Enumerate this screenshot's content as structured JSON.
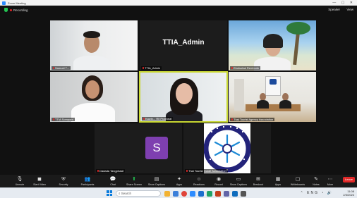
{
  "window": {
    "title": "Zoom Meeting",
    "controls": "— ▢ ✕"
  },
  "subbar": {
    "recording": "Recording",
    "speaker": "Speaker",
    "view": "View"
  },
  "tiles": [
    {
      "name": "Samuel T..."
    },
    {
      "name": "TTIA_Admin",
      "big_label": "TTIA_Admin"
    },
    {
      "name": "Ebulsotad Rembonk"
    },
    {
      "name": "TTIA Somporn"
    },
    {
      "name": "Kawin... Rit Prakheat"
    },
    {
      "name": "Thai Tourist Agency Association"
    },
    {
      "name": "Dadada Tangphasit",
      "avatar_letter": "S"
    },
    {
      "name": "Thai Tourist Guide Association"
    }
  ],
  "toolbar": {
    "items": [
      "Unmute",
      "Start Video",
      "Security",
      "Participants",
      "Chat",
      "Share Screen",
      "Show Captions",
      "Apps",
      "Reactions",
      "Record",
      "Show Captions",
      "Breakout",
      "Apps",
      "Whiteboards",
      "Notes",
      "More"
    ],
    "end": "Leave"
  },
  "taskbar": {
    "search_placeholder": "Search",
    "lang": "ENG",
    "time": "11:08",
    "date": "2/3/2024"
  },
  "icons": {
    "mic": "mic-off-icon",
    "video": "video-off-icon",
    "shield": "security-shield-icon",
    "windows": "windows-start-icon"
  }
}
